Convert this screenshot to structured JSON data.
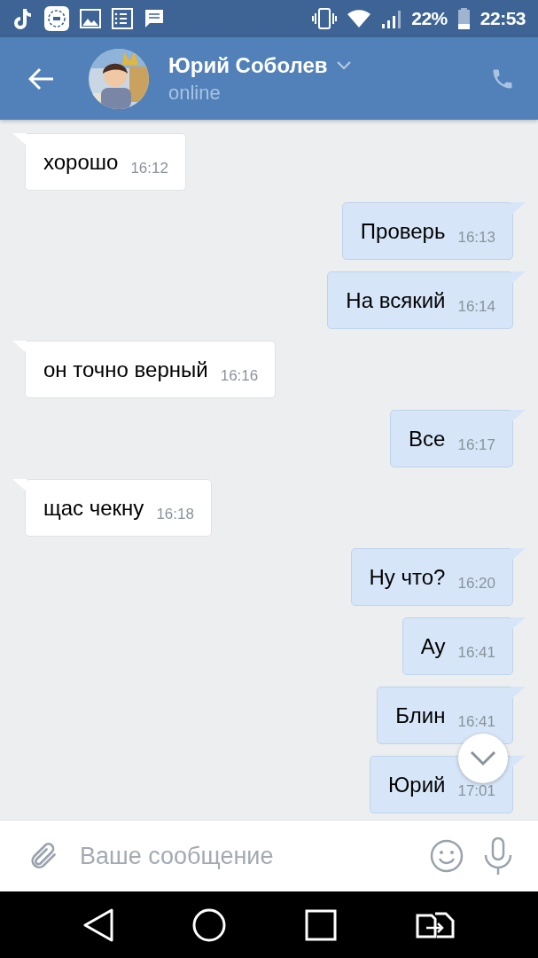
{
  "status_bar": {
    "battery": "22%",
    "time": "22:53"
  },
  "header": {
    "name": "Юрий Соболев",
    "status": "online"
  },
  "messages": [
    {
      "kind": "incoming",
      "text": "хорошо",
      "time": "16:12"
    },
    {
      "kind": "outgoing",
      "text": "Проверь",
      "time": "16:13"
    },
    {
      "kind": "outgoing",
      "text": "На всякий",
      "time": "16:14"
    },
    {
      "kind": "incoming",
      "text": "он точно верный",
      "time": "16:16"
    },
    {
      "kind": "outgoing",
      "text": "Все",
      "time": "16:17"
    },
    {
      "kind": "incoming",
      "text": "щас чекну",
      "time": "16:18"
    },
    {
      "kind": "outgoing",
      "text": "Ну что?",
      "time": "16:20"
    },
    {
      "kind": "outgoing",
      "text": "Ау",
      "time": "16:41"
    },
    {
      "kind": "outgoing",
      "text": "Блин",
      "time": "16:41"
    },
    {
      "kind": "outgoing",
      "text": "Юрий",
      "time": "17:01"
    }
  ],
  "composer": {
    "placeholder": "Ваше сообщение"
  }
}
